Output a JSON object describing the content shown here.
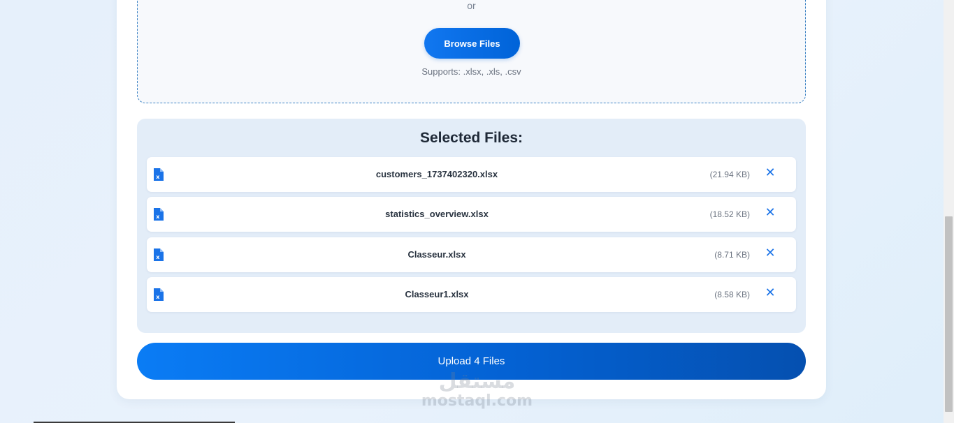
{
  "dropzone": {
    "or_text": "or",
    "browse_label": "Browse Files",
    "supports_text": "Supports: .xlsx, .xls, .csv"
  },
  "selected": {
    "title": "Selected Files:",
    "files": [
      {
        "name": "customers_1737402320.xlsx",
        "size": "(21.94 KB)",
        "icon": "excel-file-icon",
        "remove_icon": "close-icon"
      },
      {
        "name": "statistics_overview.xlsx",
        "size": "(18.52 KB)",
        "icon": "excel-file-icon",
        "remove_icon": "close-icon"
      },
      {
        "name": "Classeur.xlsx",
        "size": "(8.71 KB)",
        "icon": "excel-file-icon",
        "remove_icon": "close-icon"
      },
      {
        "name": "Classeur1.xlsx",
        "size": "(8.58 KB)",
        "icon": "excel-file-icon",
        "remove_icon": "close-icon"
      }
    ],
    "remove_glyph": "✕"
  },
  "upload": {
    "label": "Upload 4 Files"
  },
  "watermark": {
    "arabic": "مستقل",
    "latin": "mostaql.com"
  },
  "colors": {
    "accent": "#1a73e8",
    "button_gradient_start": "#0a7cf5",
    "button_gradient_end": "#0550b0",
    "panel_bg": "#e3edf8",
    "page_bg": "#e6f0fb"
  }
}
